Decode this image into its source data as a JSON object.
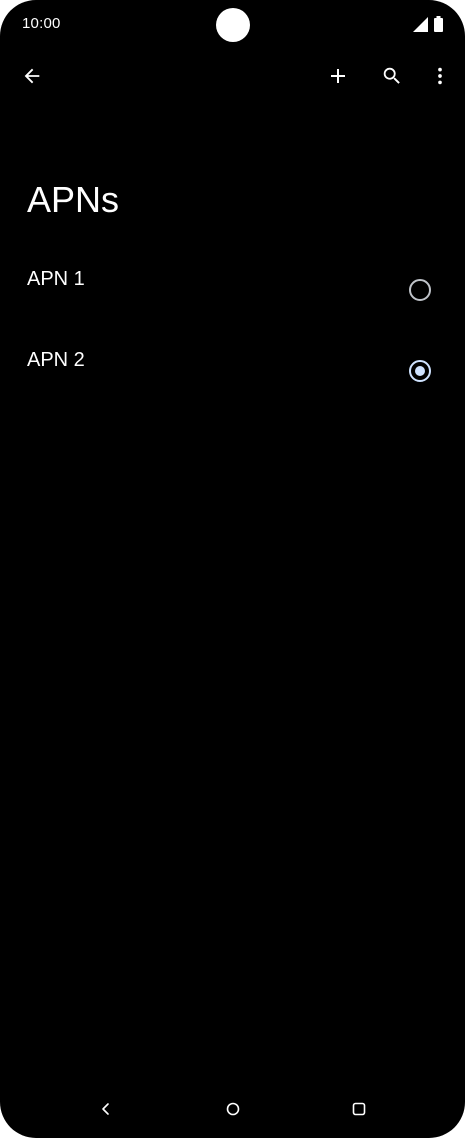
{
  "status_bar": {
    "time": "10:00",
    "icons": [
      "signal-icon",
      "battery-icon"
    ]
  },
  "app_bar": {
    "actions": [
      "back-arrow-icon",
      "add-icon",
      "search-icon",
      "more-vert-icon"
    ]
  },
  "page": {
    "title": "APNs"
  },
  "apns": [
    {
      "label": "APN 1",
      "selected": false
    },
    {
      "label": "APN 2",
      "selected": true
    }
  ],
  "nav_bar": {
    "buttons": [
      "nav-back-icon",
      "nav-home-icon",
      "nav-recents-icon"
    ]
  },
  "colors": {
    "background": "#000000",
    "text": "#ffffff",
    "radio_unselected": "#bfc3c9",
    "radio_selected": "#cfe3ff"
  }
}
